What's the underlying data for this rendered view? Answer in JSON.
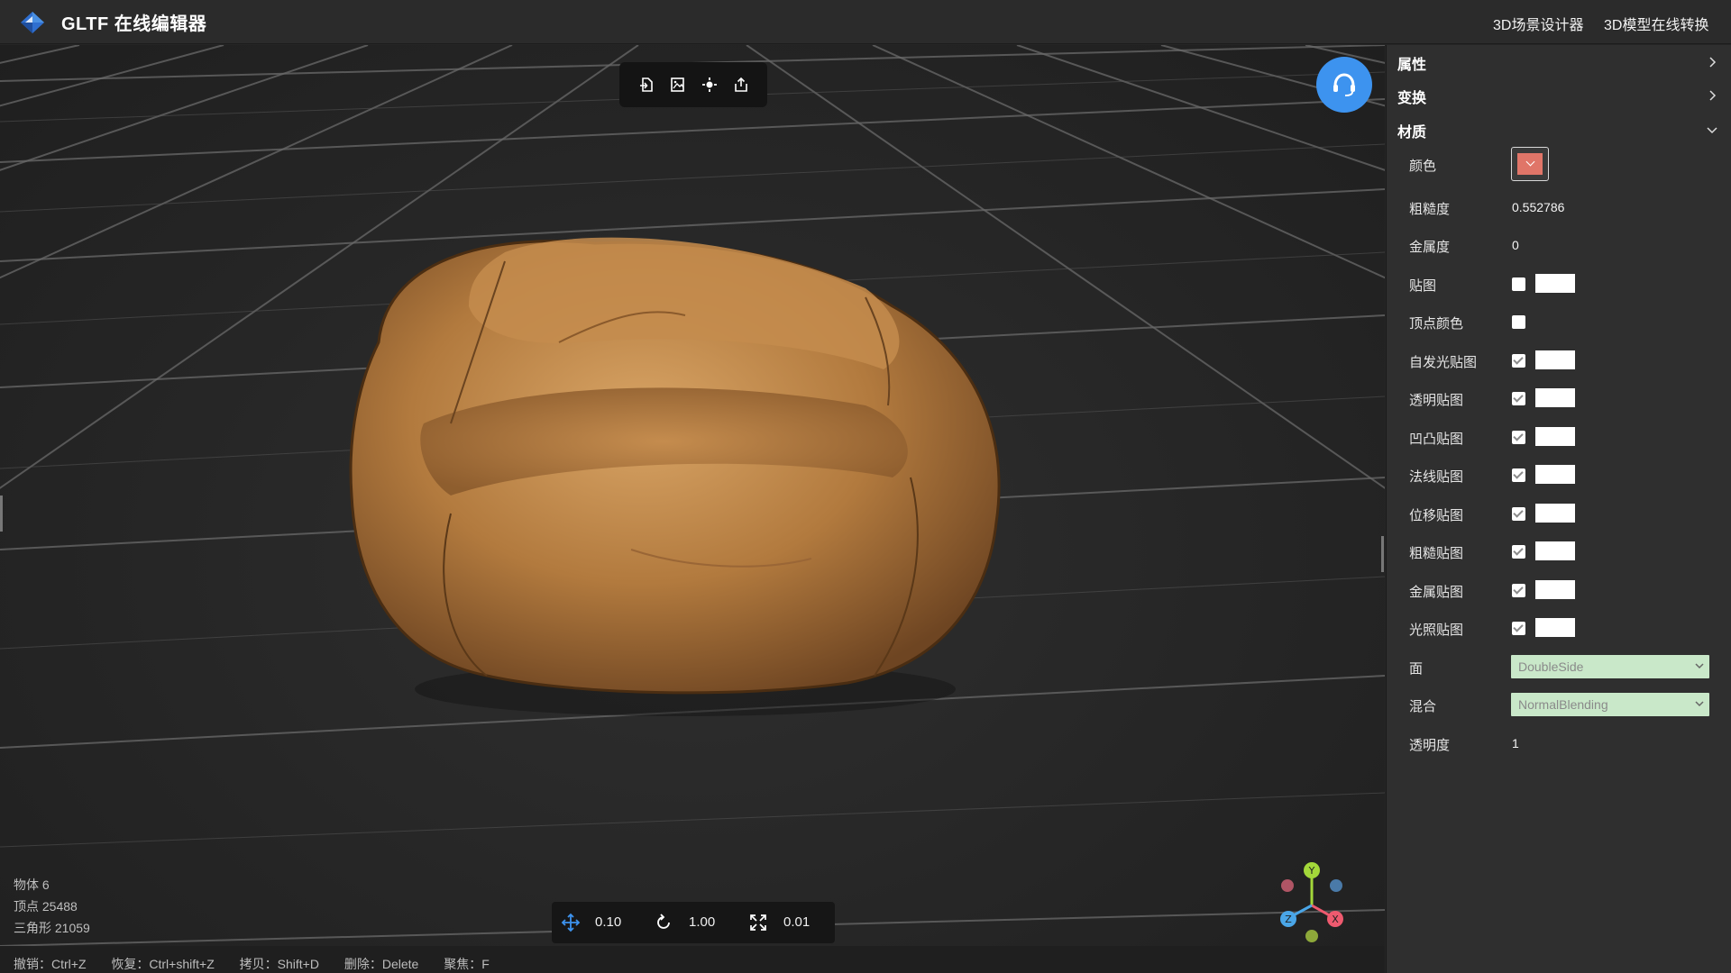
{
  "header": {
    "title": "GLTF 在线编辑器",
    "nav": [
      "3D场景设计器",
      "3D模型在线转换"
    ]
  },
  "viewport": {
    "stats": {
      "objects": "物体 6",
      "vertices": "顶点 25488",
      "triangles": "三角形 21059"
    },
    "transform": {
      "translate_step": "0.10",
      "rotate_step": "1.00",
      "scale_step": "0.01"
    },
    "shortcuts": [
      "撤销：Ctrl+Z",
      "恢复：Ctrl+shift+Z",
      "拷贝：Shift+D",
      "删除：Delete",
      "聚焦：F"
    ],
    "gizmo_axes": [
      "Y",
      "X",
      "Z"
    ],
    "toolbar_icons": [
      "import-icon",
      "import-image-icon",
      "light-icon",
      "export-icon"
    ]
  },
  "panel": {
    "sections": {
      "properties": "属性",
      "transform": "变换",
      "material": "材质"
    },
    "material": {
      "color_label": "颜色",
      "color_value": "#e07568",
      "roughness_label": "粗糙度",
      "roughness": "0.552786",
      "metalness_label": "金属度",
      "metalness": "0",
      "maps": [
        {
          "label": "贴图",
          "checked": false,
          "slot": true
        },
        {
          "label": "顶点颜色",
          "checked": false,
          "slot": false
        },
        {
          "label": "自发光贴图",
          "checked": true,
          "slot": true
        },
        {
          "label": "透明贴图",
          "checked": true,
          "slot": true
        },
        {
          "label": "凹凸贴图",
          "checked": true,
          "slot": true
        },
        {
          "label": "法线贴图",
          "checked": true,
          "slot": true
        },
        {
          "label": "位移贴图",
          "checked": true,
          "slot": true
        },
        {
          "label": "粗糙贴图",
          "checked": true,
          "slot": true
        },
        {
          "label": "金属贴图",
          "checked": true,
          "slot": true
        },
        {
          "label": "光照贴图",
          "checked": true,
          "slot": true
        }
      ],
      "side_label": "面",
      "side_value": "DoubleSide",
      "blend_label": "混合",
      "blend_value": "NormalBlending",
      "opacity_label": "透明度",
      "opacity": "1"
    }
  },
  "colors": {
    "accent": "#3d93ef",
    "select_bg": "#c9e8c9",
    "gizmo_x": "#ef5a6f",
    "gizmo_y": "#a3d83a",
    "gizmo_z": "#4aa6e8"
  }
}
